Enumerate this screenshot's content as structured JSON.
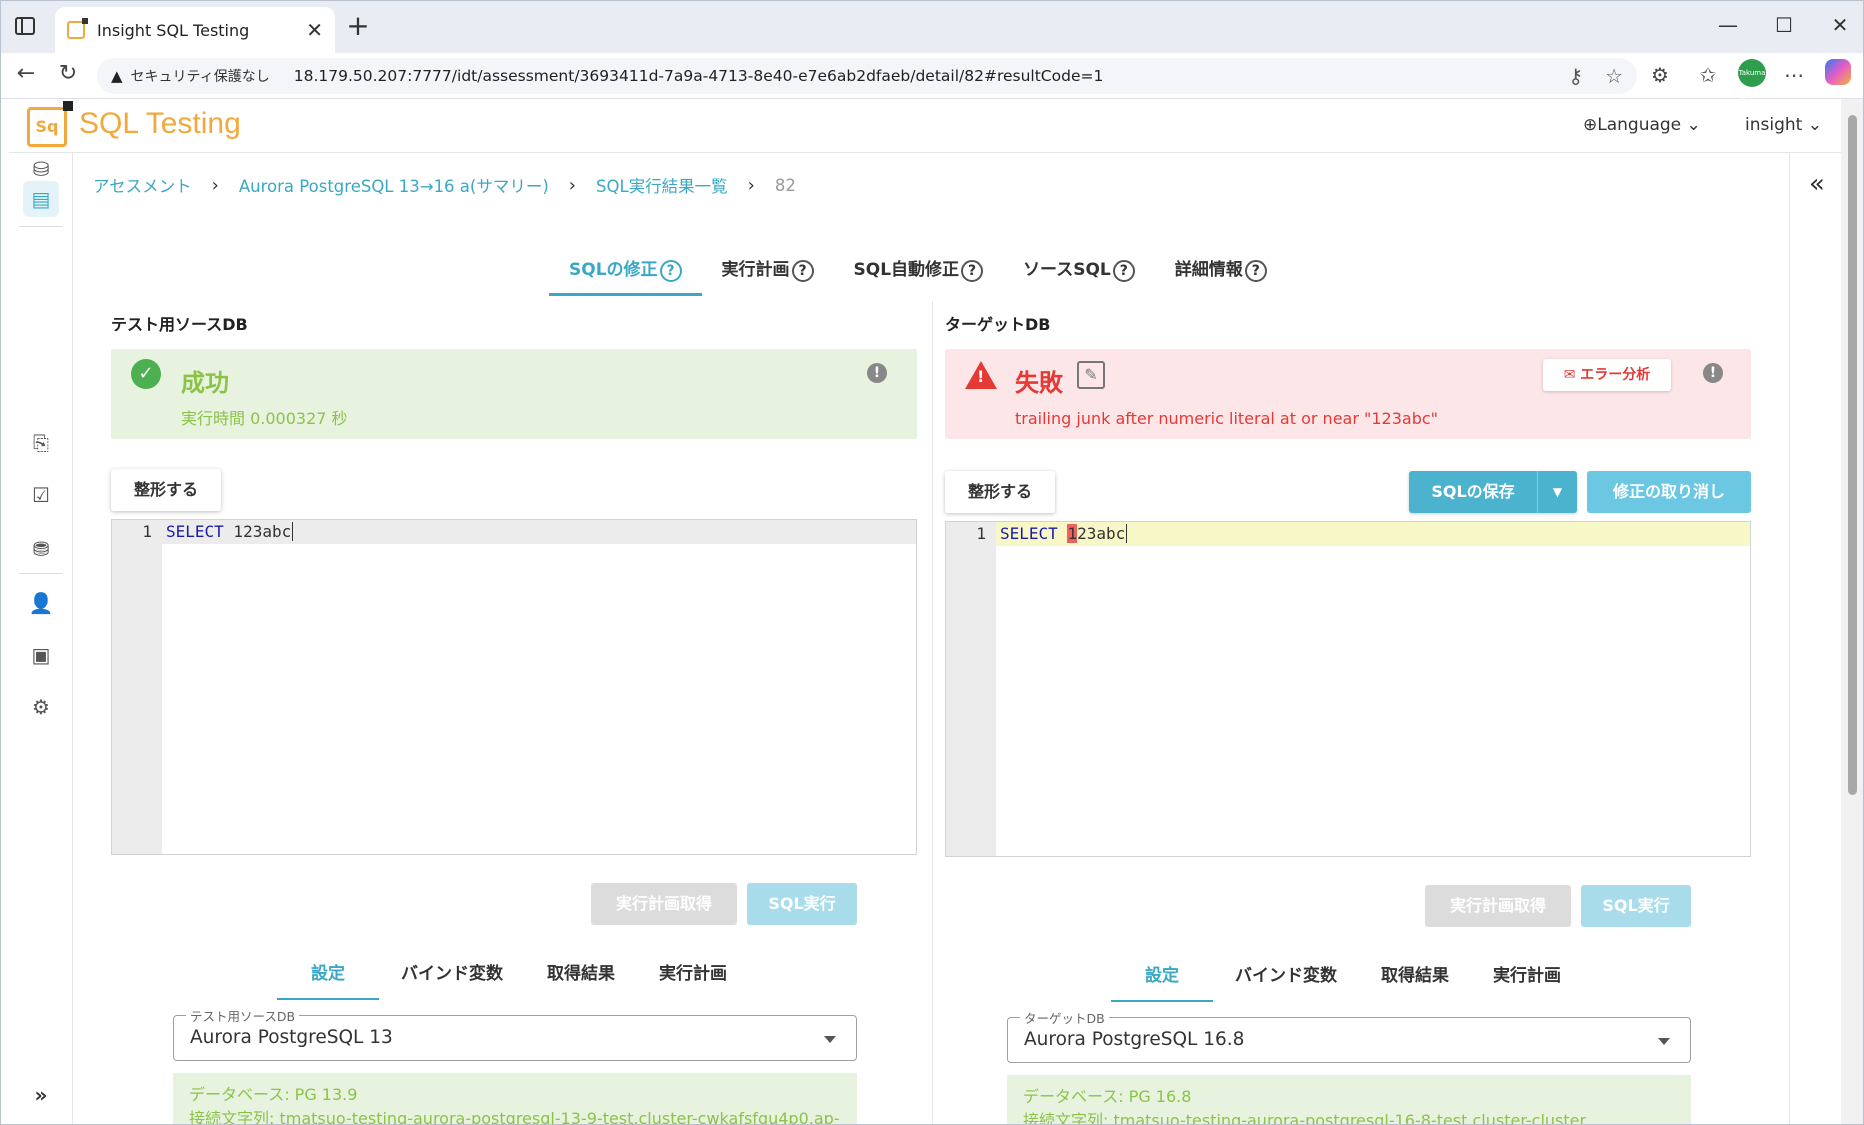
{
  "browser": {
    "tab_title": "Insight SQL Testing",
    "security_label": "セキュリティ保護なし",
    "url": "18.179.50.207:7777/idt/assessment/3693411d-7a9a-4713-8e40-e7e6ab2dfaeb/detail/82#resultCode=1",
    "avatar_text": "Takuma Matsuo"
  },
  "header": {
    "logo_text": "Sq",
    "brand": "SQL Testing",
    "language": "Language",
    "user": "insight"
  },
  "breadcrumb": [
    {
      "label": "アセスメント"
    },
    {
      "label": "Aurora PostgreSQL 13→16 a(サマリー)"
    },
    {
      "label": "SQL実行結果一覧"
    },
    {
      "label": "82"
    }
  ],
  "tabs": [
    {
      "label": "SQLの修正",
      "active": true
    },
    {
      "label": "実行計画",
      "active": false
    },
    {
      "label": "SQL自動修正",
      "active": false
    },
    {
      "label": "ソースSQL",
      "active": false
    },
    {
      "label": "詳細情報",
      "active": false
    }
  ],
  "source": {
    "title": "テスト用ソースDB",
    "status": "成功",
    "exec_time": "実行時間 0.000327 秒",
    "format_btn": "整形する",
    "line_no": "1",
    "sql_keyword": "SELECT",
    "sql_rest": " 123abc",
    "plan_btn": "実行計画取得",
    "run_btn": "SQL実行",
    "subtabs": [
      "設定",
      "バインド変数",
      "取得結果",
      "実行計画"
    ],
    "select_legend": "テスト用ソースDB",
    "select_value": "Aurora PostgreSQL 13",
    "db_line1": "データベース: PG 13.9",
    "db_line2": "接続文字列: tmatsuo-testing-aurora-postgresql-13-9-test.cluster-cwkafsfgu4p0.ap-"
  },
  "target": {
    "title": "ターゲットDB",
    "status": "失敗",
    "error_btn": "エラー分析",
    "error_msg": "trailing junk after numeric literal at or near \"123abc\"",
    "format_btn": "整形する",
    "save_btn": "SQLの保存",
    "cancel_btn": "修正の取り消し",
    "line_no": "1",
    "sql_keyword": "SELECT",
    "sql_err_char": "1",
    "sql_rest": "23abc",
    "plan_btn": "実行計画取得",
    "run_btn": "SQL実行",
    "subtabs": [
      "設定",
      "バインド変数",
      "取得結果",
      "実行計画"
    ],
    "select_legend": "ターゲットDB",
    "select_value": "Aurora PostgreSQL 16.8",
    "db_line1": "データベース: PG 16.8",
    "db_line2": "接続文字列: tmatsuo-testing-aurora-postgresql-16-8-test.cluster-cluster"
  },
  "colors": {
    "accent": "#3aa8c4",
    "success_bg": "#e8f3df",
    "success_text": "#8bc34a",
    "error_bg": "#fde6e8",
    "error_text": "#e53935",
    "brand": "#f2a93b"
  }
}
